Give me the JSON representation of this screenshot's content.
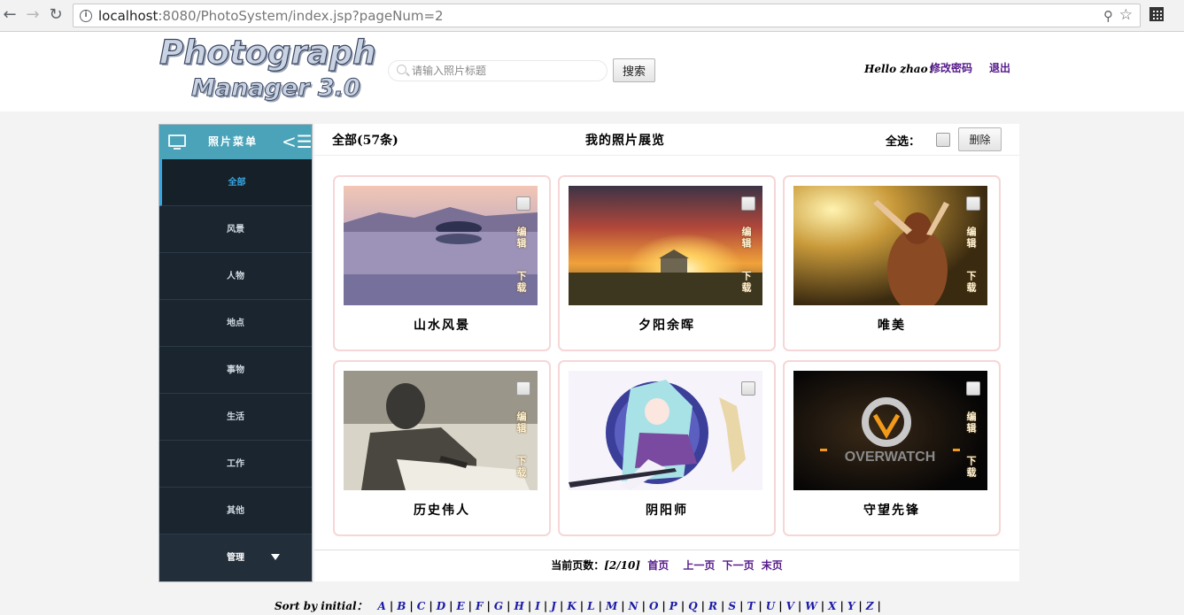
{
  "browser": {
    "url_host": "localhost",
    "url_rest": ":8080/PhotoSystem/index.jsp?pageNum=2"
  },
  "header": {
    "logo_line1": "Photograph",
    "logo_line2": "Manager 3.0",
    "search_placeholder": "请输入照片标题",
    "search_button": "搜索",
    "greeting": "Hello zhao！",
    "change_password": "修改密码",
    "logout": "退出"
  },
  "sidebar": {
    "title": "照片菜单",
    "items": [
      {
        "label": "全部"
      },
      {
        "label": "风景"
      },
      {
        "label": "人物"
      },
      {
        "label": "地点"
      },
      {
        "label": "事物"
      },
      {
        "label": "生活"
      },
      {
        "label": "工作"
      },
      {
        "label": "其他"
      }
    ],
    "manage_label": "管理"
  },
  "main": {
    "count_label": "全部(57条)",
    "title": "我的照片展览",
    "select_all_label": "全选：",
    "delete_button": "删除",
    "edit_label": "编辑",
    "download_label": "下载",
    "photos": [
      {
        "title": "山水风景"
      },
      {
        "title": "夕阳余晖"
      },
      {
        "title": "唯美"
      },
      {
        "title": "历史伟人"
      },
      {
        "title": "阴阳师"
      },
      {
        "title": "守望先锋"
      }
    ],
    "overwatch_text": "OVERWATCH",
    "pager": {
      "label": "当前页数：",
      "current": "[2/10]",
      "first": "首页",
      "prev": "上一页",
      "next": "下一页",
      "last": "末页"
    }
  },
  "footer": {
    "sort_label": "Sort by initial：",
    "letters": [
      "A",
      "B",
      "C",
      "D",
      "E",
      "F",
      "G",
      "H",
      "I",
      "J",
      "K",
      "L",
      "M",
      "N",
      "O",
      "P",
      "Q",
      "R",
      "S",
      "T",
      "U",
      "V",
      "W",
      "X",
      "Y",
      "Z"
    ]
  }
}
